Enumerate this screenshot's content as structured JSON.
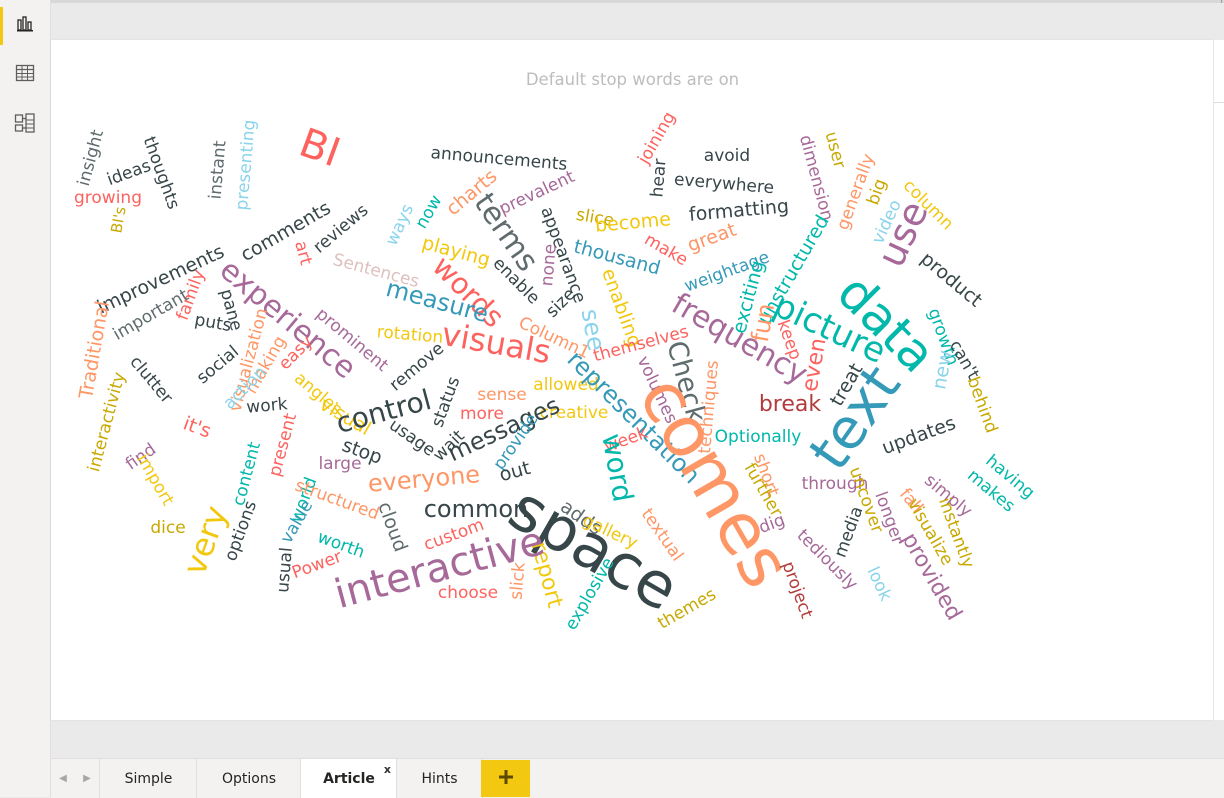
{
  "sidebar": {
    "items": [
      {
        "name": "report-view-icon",
        "label": "Report"
      },
      {
        "name": "data-view-icon",
        "label": "Data"
      },
      {
        "name": "model-view-icon",
        "label": "Model"
      }
    ],
    "accent_color": "#f2c811"
  },
  "visual": {
    "title": "Default stop words are on"
  },
  "tabs": {
    "pages": [
      "Simple",
      "Options",
      "Article",
      "Hints"
    ],
    "active": "Article",
    "close_label": "x",
    "add_label": "+"
  },
  "colors": {
    "teal": "#01b8aa",
    "dark": "#374649",
    "red": "#fd625e",
    "yellow": "#f2c80f",
    "gray": "#5f6b6d",
    "blue": "#8ad4eb",
    "orange": "#fe9666",
    "purple": "#a66999",
    "darkblue": "#3599b8",
    "lightblue": "#dfbfbf"
  },
  "words": [
    {
      "t": "insight",
      "c": "#5f6b6d"
    },
    {
      "t": "growing",
      "c": "#fd625e"
    },
    {
      "t": "ideas",
      "c": "#374649"
    },
    {
      "t": "thoughts",
      "c": "#374649"
    },
    {
      "t": "BI's",
      "c": "#c8a800"
    },
    {
      "t": "instant",
      "c": "#5f6b6d"
    },
    {
      "t": "presenting",
      "c": "#8ad4eb"
    },
    {
      "t": "BI",
      "c": "#fd625e"
    },
    {
      "t": "announcements",
      "c": "#374649"
    },
    {
      "t": "joining",
      "c": "#fd625e"
    },
    {
      "t": "hear",
      "c": "#374649"
    },
    {
      "t": "avoid",
      "c": "#374649"
    },
    {
      "t": "everywhere",
      "c": "#374649"
    },
    {
      "t": "dimension",
      "c": "#a66999"
    },
    {
      "t": "user",
      "c": "#c8a800"
    },
    {
      "t": "generally",
      "c": "#fe9666"
    },
    {
      "t": "big",
      "c": "#c8a800"
    },
    {
      "t": "column",
      "c": "#f2c80f"
    },
    {
      "t": "video",
      "c": "#8ad4eb"
    },
    {
      "t": "use",
      "c": "#a66999"
    },
    {
      "t": "charts",
      "c": "#fe9666"
    },
    {
      "t": "prevalent",
      "c": "#a66999"
    },
    {
      "t": "terms",
      "c": "#5f6b6d"
    },
    {
      "t": "formatting",
      "c": "#374649"
    },
    {
      "t": "slice",
      "c": "#c8a800"
    },
    {
      "t": "become",
      "c": "#f2c80f"
    },
    {
      "t": "make",
      "c": "#fd625e"
    },
    {
      "t": "great",
      "c": "#fe9666"
    },
    {
      "t": "unstructured",
      "c": "#01b8aa"
    },
    {
      "t": "product",
      "c": "#374649"
    },
    {
      "t": "comments",
      "c": "#374649"
    },
    {
      "t": "reviews",
      "c": "#374649"
    },
    {
      "t": "ways",
      "c": "#8ad4eb"
    },
    {
      "t": "now",
      "c": "#01b8aa"
    },
    {
      "t": "appearance",
      "c": "#374649"
    },
    {
      "t": "thousand",
      "c": "#3599b8"
    },
    {
      "t": "playing",
      "c": "#f2c80f"
    },
    {
      "t": "enable",
      "c": "#374649"
    },
    {
      "t": "none",
      "c": "#a66999"
    },
    {
      "t": "art",
      "c": "#fd625e"
    },
    {
      "t": "Sentences",
      "c": "#dfbfbf"
    },
    {
      "t": "words",
      "c": "#fd625e"
    },
    {
      "t": "weightage",
      "c": "#3599b8"
    },
    {
      "t": "exciting",
      "c": "#01b8aa"
    },
    {
      "t": "data",
      "c": "#01b8aa"
    },
    {
      "t": "growth",
      "c": "#01b8aa"
    },
    {
      "t": "improvements",
      "c": "#374649"
    },
    {
      "t": "family",
      "c": "#fd625e"
    },
    {
      "t": "important",
      "c": "#5f6b6d"
    },
    {
      "t": "experience",
      "c": "#a66999"
    },
    {
      "t": "pane",
      "c": "#374649"
    },
    {
      "t": "measure",
      "c": "#3599b8"
    },
    {
      "t": "size",
      "c": "#374649"
    },
    {
      "t": "enabling",
      "c": "#f2c80f"
    },
    {
      "t": "frequency",
      "c": "#a66999"
    },
    {
      "t": "picture",
      "c": "#01b8aa"
    },
    {
      "t": "new",
      "c": "#8ad4eb"
    },
    {
      "t": "Traditional",
      "c": "#fe9666"
    },
    {
      "t": "puts",
      "c": "#374649"
    },
    {
      "t": "visualization",
      "c": "#fe9666"
    },
    {
      "t": "prominent",
      "c": "#a66999"
    },
    {
      "t": "rotation",
      "c": "#f2c80f"
    },
    {
      "t": "visuals",
      "c": "#fd625e"
    },
    {
      "t": "Column1",
      "c": "#fe9666"
    },
    {
      "t": "see",
      "c": "#8ad4eb"
    },
    {
      "t": "fun",
      "c": "#fe9666"
    },
    {
      "t": "keep",
      "c": "#fd625e"
    },
    {
      "t": "can't",
      "c": "#374649"
    },
    {
      "t": "social",
      "c": "#374649"
    },
    {
      "t": "making",
      "c": "#fe9666"
    },
    {
      "t": "easy",
      "c": "#fd625e"
    },
    {
      "t": "themselves",
      "c": "#fd625e"
    },
    {
      "t": "even",
      "c": "#fd625e"
    },
    {
      "t": "clutter",
      "c": "#374649"
    },
    {
      "t": "remove",
      "c": "#374649"
    },
    {
      "t": "volumes",
      "c": "#a66999"
    },
    {
      "t": "Check",
      "c": "#5f6b6d"
    },
    {
      "t": "techniques",
      "c": "#fe9666"
    },
    {
      "t": "break",
      "c": "#b33b3b"
    },
    {
      "t": "treat",
      "c": "#374649"
    },
    {
      "t": "text",
      "c": "#3599b8"
    },
    {
      "t": "behind",
      "c": "#c8a800"
    },
    {
      "t": "interactivity",
      "c": "#c8a800"
    },
    {
      "t": "action",
      "c": "#8ad4eb"
    },
    {
      "t": "work",
      "c": "#374649"
    },
    {
      "t": "angles",
      "c": "#f2c80f"
    },
    {
      "t": "visual",
      "c": "#f2c80f"
    },
    {
      "t": "control",
      "c": "#374649"
    },
    {
      "t": "status",
      "c": "#374649"
    },
    {
      "t": "sense",
      "c": "#fe9666"
    },
    {
      "t": "allowed",
      "c": "#f2c80f"
    },
    {
      "t": "creative",
      "c": "#f2c80f"
    },
    {
      "t": "representation",
      "c": "#3599b8"
    },
    {
      "t": "it's",
      "c": "#fd625e"
    },
    {
      "t": "more",
      "c": "#fd625e"
    },
    {
      "t": "messages",
      "c": "#374649"
    },
    {
      "t": "find",
      "c": "#a66999"
    },
    {
      "t": "usage",
      "c": "#374649"
    },
    {
      "t": "wait",
      "c": "#374649"
    },
    {
      "t": "provide",
      "c": "#3599b8"
    },
    {
      "t": "week",
      "c": "#fd625e"
    },
    {
      "t": "Optionally",
      "c": "#01b8aa"
    },
    {
      "t": "updates",
      "c": "#374649"
    },
    {
      "t": "having",
      "c": "#01b8aa"
    },
    {
      "t": "present",
      "c": "#fd625e"
    },
    {
      "t": "stop",
      "c": "#374649"
    },
    {
      "t": "large",
      "c": "#a66999"
    },
    {
      "t": "short",
      "c": "#fe9666"
    },
    {
      "t": "through",
      "c": "#a66999"
    },
    {
      "t": "uncover",
      "c": "#c8a800"
    },
    {
      "t": "makes",
      "c": "#01b8aa"
    },
    {
      "t": "import",
      "c": "#f2c80f"
    },
    {
      "t": "content",
      "c": "#01b8aa"
    },
    {
      "t": "everyone",
      "c": "#fe9666"
    },
    {
      "t": "out",
      "c": "#374649"
    },
    {
      "t": "word",
      "c": "#01b8aa"
    },
    {
      "t": "comes",
      "c": "#fe9666"
    },
    {
      "t": "further",
      "c": "#c8a800"
    },
    {
      "t": "simply",
      "c": "#a66999"
    },
    {
      "t": "very",
      "c": "#f2c80f"
    },
    {
      "t": "world",
      "c": "#01b8aa"
    },
    {
      "t": "structured",
      "c": "#fe9666"
    },
    {
      "t": "adds",
      "c": "#5f6b6d"
    },
    {
      "t": "fall",
      "c": "#fe9666"
    },
    {
      "t": "dice",
      "c": "#c8a800"
    },
    {
      "t": "value",
      "c": "#3599b8"
    },
    {
      "t": "common",
      "c": "#374649"
    },
    {
      "t": "gallery",
      "c": "#f2c80f"
    },
    {
      "t": "dig",
      "c": "#a66999"
    },
    {
      "t": "longer",
      "c": "#a66999"
    },
    {
      "t": "visualize",
      "c": "#c8a800"
    },
    {
      "t": "instantly",
      "c": "#c8a800"
    },
    {
      "t": "options",
      "c": "#374649"
    },
    {
      "t": "worth",
      "c": "#01b8aa"
    },
    {
      "t": "cloud",
      "c": "#5f6b6d"
    },
    {
      "t": "space",
      "c": "#374649"
    },
    {
      "t": "textual",
      "c": "#fe9666"
    },
    {
      "t": "media",
      "c": "#374649"
    },
    {
      "t": "custom",
      "c": "#fd625e"
    },
    {
      "t": "report",
      "c": "#f2c80f"
    },
    {
      "t": "tediously",
      "c": "#a66999"
    },
    {
      "t": "look",
      "c": "#8ad4eb"
    },
    {
      "t": "provided",
      "c": "#a66999"
    },
    {
      "t": "usual",
      "c": "#374649"
    },
    {
      "t": "Power",
      "c": "#fd625e"
    },
    {
      "t": "interactive",
      "c": "#a66999"
    },
    {
      "t": "project",
      "c": "#b33b3b"
    },
    {
      "t": "choose",
      "c": "#fd625e"
    },
    {
      "t": "slick",
      "c": "#fe9666"
    },
    {
      "t": "explosive",
      "c": "#01b8aa"
    },
    {
      "t": "themes",
      "c": "#c8a800"
    }
  ]
}
